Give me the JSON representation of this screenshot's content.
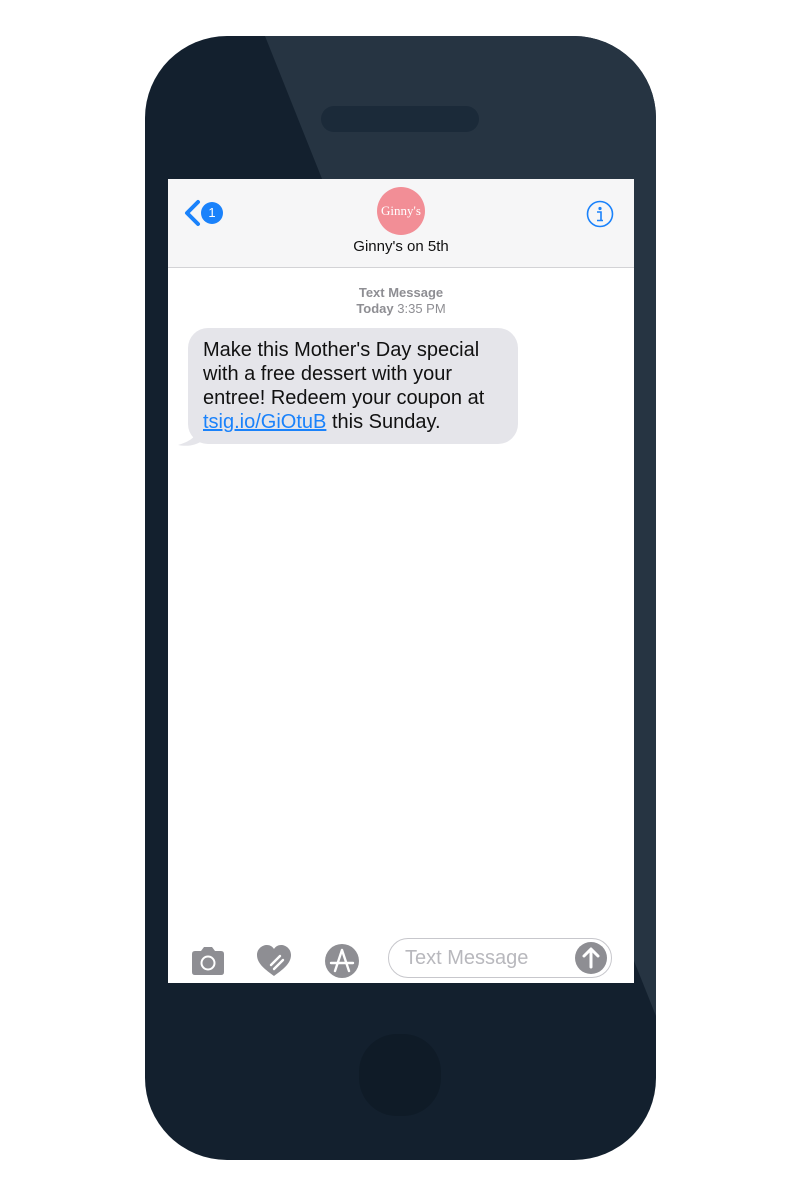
{
  "header": {
    "back_badge_count": "1",
    "avatar_text": "Ginny's",
    "contact_name": "Ginny's on 5th"
  },
  "thread": {
    "message_type": "Text Message",
    "day": "Today",
    "time": "3:35 PM",
    "message": {
      "text_before_link": "Make this Mother's Day special with a free dessert with your entree! Redeem your coupon at ",
      "link_text": "tsig.io/GiOtuB",
      "text_after_link": " this Sunday."
    }
  },
  "input_bar": {
    "placeholder": "Text Message",
    "icons": [
      "camera-icon",
      "digital-touch-icon",
      "app-store-icon",
      "send-arrow-icon",
      "info-icon",
      "back-chevron-icon"
    ]
  },
  "colors": {
    "accent": "#1a82fb",
    "avatar_bg": "#f28e96",
    "bubble_bg": "#e5e5ea",
    "phone_body": "#13202e"
  }
}
